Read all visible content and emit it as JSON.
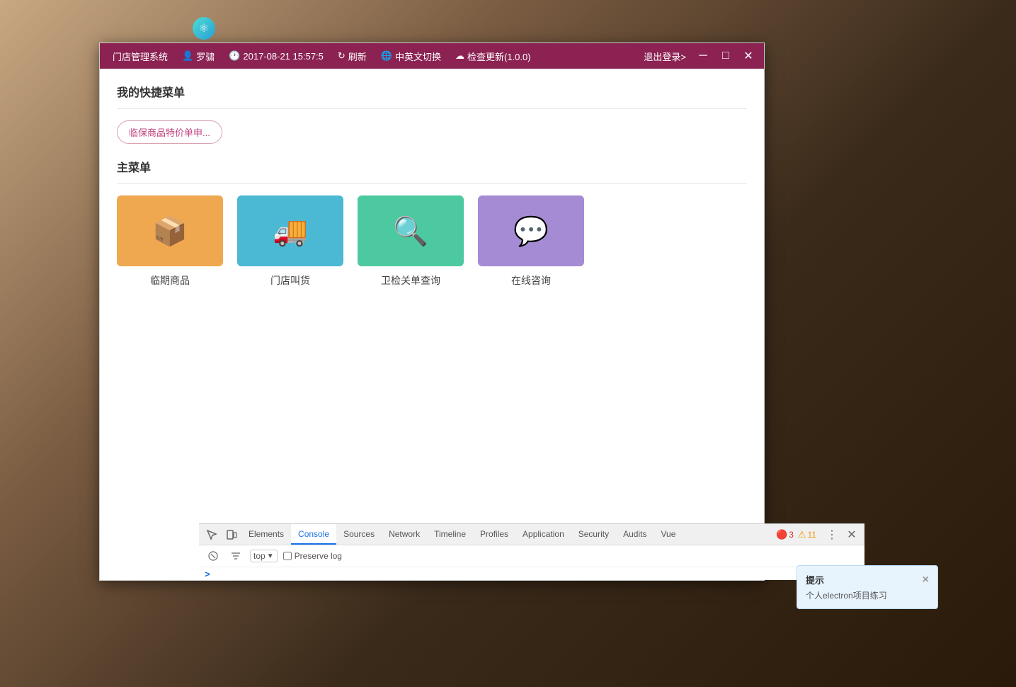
{
  "background": {
    "color": "#5a4a3a"
  },
  "app_logo": {
    "symbol": "⚛"
  },
  "title_bar": {
    "app_name": "门店管理系统",
    "user_icon": "👤",
    "username": "罗骕",
    "datetime": "2017-08-21 15:57:5",
    "refresh_label": "刷新",
    "lang_switch_label": "中英文切换",
    "check_update_label": "检查更新(1.0.0)",
    "logout_label": "退出登录>",
    "minimize_label": "─",
    "maximize_label": "□",
    "close_label": "✕"
  },
  "quick_menu": {
    "section_title": "我的快捷菜单",
    "quick_button_label": "临保商品特价单申..."
  },
  "main_menu": {
    "section_title": "主菜单",
    "items": [
      {
        "id": "linqi",
        "label": "临期商品",
        "color_class": "orange",
        "icon": "📦"
      },
      {
        "id": "mendian",
        "label": "门店叫货",
        "color_class": "blue",
        "icon": "🚚"
      },
      {
        "id": "weijian",
        "label": "卫检关单查询",
        "color_class": "green",
        "icon": "🔍"
      },
      {
        "id": "zaixian",
        "label": "在线咨询",
        "color_class": "purple",
        "icon": "💬"
      }
    ]
  },
  "devtools": {
    "tabs": [
      {
        "id": "elements",
        "label": "Elements",
        "active": false
      },
      {
        "id": "console",
        "label": "Console",
        "active": true
      },
      {
        "id": "sources",
        "label": "Sources",
        "active": false
      },
      {
        "id": "network",
        "label": "Network",
        "active": false
      },
      {
        "id": "timeline",
        "label": "Timeline",
        "active": false
      },
      {
        "id": "profiles",
        "label": "Profiles",
        "active": false
      },
      {
        "id": "application",
        "label": "Application",
        "active": false
      },
      {
        "id": "security",
        "label": "Security",
        "active": false
      },
      {
        "id": "audits",
        "label": "Audits",
        "active": false
      },
      {
        "id": "vue",
        "label": "Vue",
        "active": false
      }
    ],
    "error_count": "3",
    "warning_count": "11",
    "console_filter": "top",
    "preserve_log": "Preserve log",
    "prompt": ">"
  },
  "tooltip": {
    "title": "提示",
    "body": "个人electron项目练习",
    "close_label": "×"
  }
}
